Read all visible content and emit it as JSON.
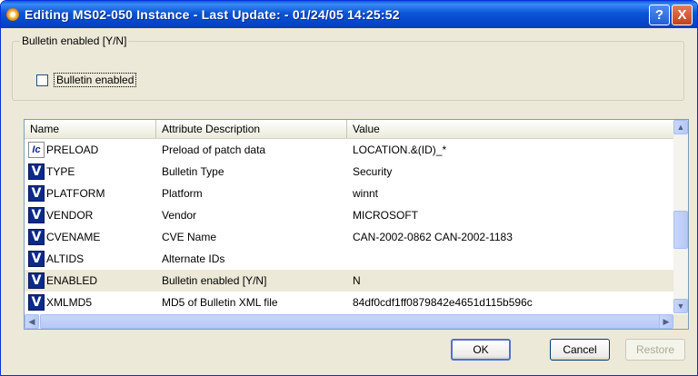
{
  "window": {
    "title": "Editing MS02-050 Instance - Last Update: - 01/24/05 14:25:52",
    "help_label": "?",
    "close_label": "X"
  },
  "group": {
    "legend": "Bulletin enabled [Y/N]",
    "checkbox_label": "Bulletin enabled",
    "checked": false
  },
  "list": {
    "columns": [
      "Name",
      "Attribute Description",
      "Value"
    ],
    "rows": [
      {
        "icon": "patch-data-icon",
        "glyph": "Ic",
        "name": "PRELOAD",
        "description": "Preload of patch data",
        "value": "LOCATION.&(ID)_*"
      },
      {
        "icon": "value-icon",
        "glyph": "V",
        "name": "TYPE",
        "description": "Bulletin Type",
        "value": "Security"
      },
      {
        "icon": "value-icon",
        "glyph": "V",
        "name": "PLATFORM",
        "description": "Platform",
        "value": "winnt"
      },
      {
        "icon": "value-icon",
        "glyph": "V",
        "name": "VENDOR",
        "description": "Vendor",
        "value": "MICROSOFT"
      },
      {
        "icon": "value-icon",
        "glyph": "V",
        "name": "CVENAME",
        "description": "CVE Name",
        "value": "CAN-2002-0862 CAN-2002-1183"
      },
      {
        "icon": "value-icon",
        "glyph": "V",
        "name": "ALTIDS",
        "description": "Alternate IDs",
        "value": ""
      },
      {
        "icon": "value-icon",
        "glyph": "V",
        "name": "ENABLED",
        "description": "Bulletin enabled [Y/N]",
        "value": "N"
      },
      {
        "icon": "value-icon",
        "glyph": "V",
        "name": "XMLMD5",
        "description": "MD5 of Bulletin XML file",
        "value": "84df0cdf1ff0879842e4651d115b596c"
      }
    ],
    "selected_row": 6
  },
  "buttons": {
    "ok": "OK",
    "cancel": "Cancel",
    "restore": "Restore"
  },
  "scroll": {
    "up": "▲",
    "down": "▼",
    "left": "◀",
    "right": "▶"
  }
}
